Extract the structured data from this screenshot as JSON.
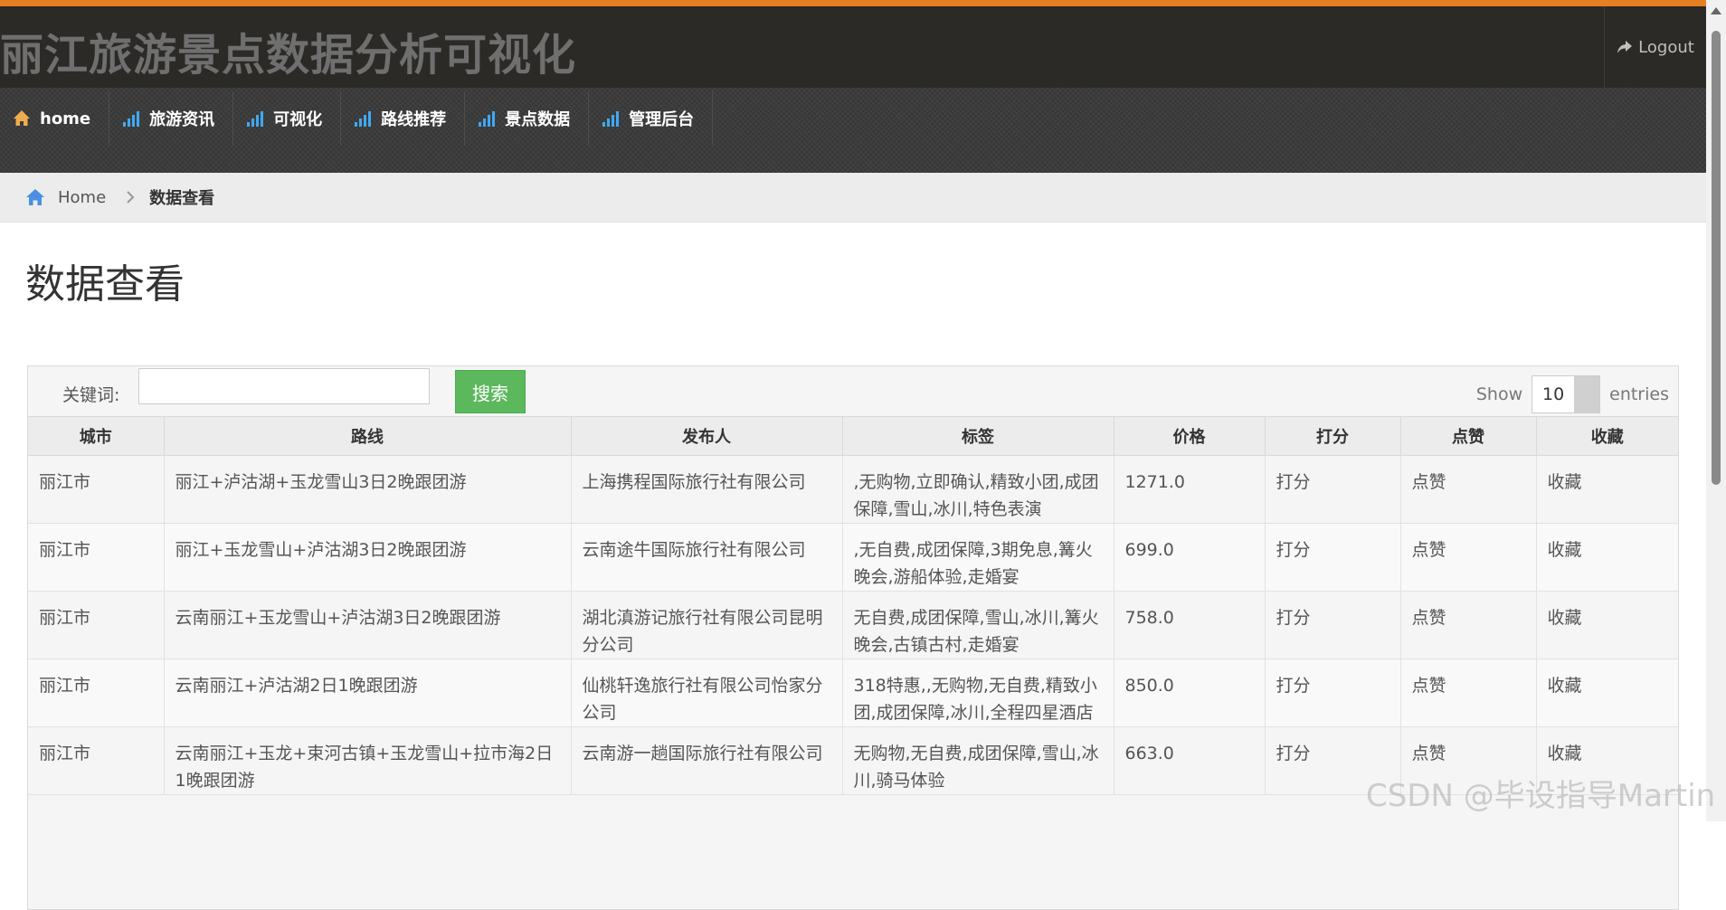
{
  "header": {
    "title": "丽江旅游景点数据分析可视化",
    "logout_label": "Logout"
  },
  "nav": {
    "items": [
      {
        "label": "home",
        "icon": "home-icon"
      },
      {
        "label": "旅游资讯",
        "icon": "signal-bars-icon"
      },
      {
        "label": "可视化",
        "icon": "signal-bars-icon"
      },
      {
        "label": "路线推荐",
        "icon": "signal-bars-icon"
      },
      {
        "label": "景点数据",
        "icon": "signal-bars-icon"
      },
      {
        "label": "管理后台",
        "icon": "signal-bars-icon"
      }
    ]
  },
  "breadcrumb": {
    "home": "Home",
    "current": "数据查看"
  },
  "page": {
    "title": "数据查看"
  },
  "toolbar": {
    "keyword_label": "关键词:",
    "keyword_value": "",
    "search_label": "搜索",
    "show_label": "Show",
    "entries_value": "10",
    "entries_label": "entries"
  },
  "table": {
    "headers": [
      "城市",
      "路线",
      "发布人",
      "标签",
      "价格",
      "打分",
      "点赞",
      "收藏"
    ],
    "rows": [
      [
        "丽江市",
        "丽江+泸沽湖+玉龙雪山3日2晚跟团游",
        "上海携程国际旅行社有限公司",
        ",无购物,立即确认,精致小团,成团保障,雪山,冰川,特色表演",
        "1271.0",
        "打分",
        "点赞",
        "收藏"
      ],
      [
        "丽江市",
        "丽江+玉龙雪山+泸沽湖3日2晚跟团游",
        "云南途牛国际旅行社有限公司",
        ",无自费,成团保障,3期免息,篝火晚会,游船体验,走婚宴",
        "699.0",
        "打分",
        "点赞",
        "收藏"
      ],
      [
        "丽江市",
        "云南丽江+玉龙雪山+泸沽湖3日2晚跟团游",
        "湖北滇游记旅行社有限公司昆明分公司",
        "无自费,成团保障,雪山,冰川,篝火晚会,古镇古村,走婚宴",
        "758.0",
        "打分",
        "点赞",
        "收藏"
      ],
      [
        "丽江市",
        "云南丽江+泸沽湖2日1晚跟团游",
        "仙桃轩逸旅行社有限公司怡家分公司",
        "318特惠,,无购物,无自费,精致小团,成团保障,冰川,全程四星酒店",
        "850.0",
        "打分",
        "点赞",
        "收藏"
      ],
      [
        "丽江市",
        "云南丽江+玉龙+束河古镇+玉龙雪山+拉市海2日1晚跟团游",
        "云南游一趟国际旅行社有限公司",
        "无购物,无自费,成团保障,雪山,冰川,骑马体验",
        "663.0",
        "打分",
        "点赞",
        "收藏"
      ]
    ]
  },
  "watermark": "CSDN @毕设指导Martin",
  "colors": {
    "accent_top": "#e67e22",
    "header_bg": "#2c2a27",
    "nav_bg": "#3a3a3a",
    "search_button": "#5cb85c",
    "nav_icon": "#3fa9f5",
    "home_icon": "#f0ad4e"
  }
}
